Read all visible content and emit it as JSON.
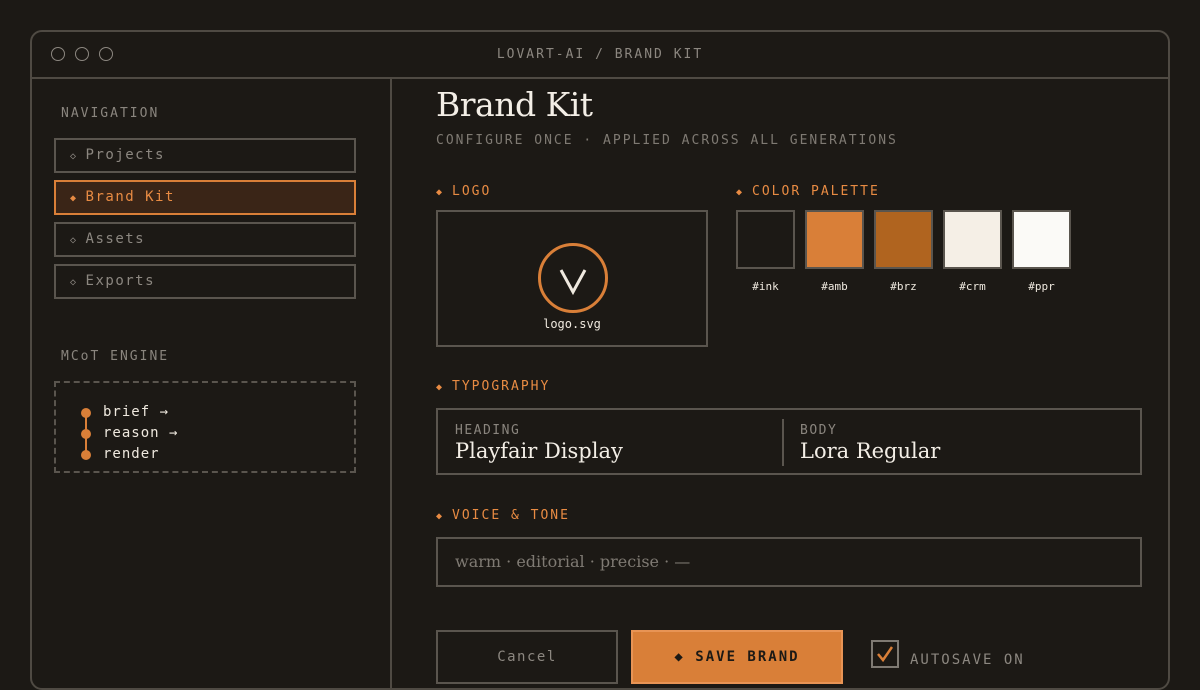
{
  "window": {
    "title": "LOVART-AI / BRAND KIT"
  },
  "sidebar": {
    "nav_label": "NAVIGATION",
    "items": [
      {
        "label": "Projects",
        "active": false
      },
      {
        "label": "Brand Kit",
        "active": true
      },
      {
        "label": "Assets",
        "active": false
      },
      {
        "label": "Exports",
        "active": false
      }
    ],
    "engine_label": "MCoT ENGINE",
    "engine_steps": [
      "brief →",
      "reason →",
      "render"
    ]
  },
  "main": {
    "title": "Brand Kit",
    "subtitle": "CONFIGURE ONCE · APPLIED ACROSS ALL GENERATIONS",
    "logo": {
      "label": "LOGO",
      "filename": "logo.svg"
    },
    "palette": {
      "label": "COLOR PALETTE",
      "swatches": [
        {
          "name": "#ink",
          "color": "#1c1915"
        },
        {
          "name": "#amb",
          "color": "#d97f38"
        },
        {
          "name": "#brz",
          "color": "#b0641f"
        },
        {
          "name": "#crm",
          "color": "#f5efe6"
        },
        {
          "name": "#ppr",
          "color": "#fbfaf7"
        }
      ]
    },
    "typography": {
      "label": "TYPOGRAPHY",
      "heading_caption": "HEADING",
      "heading_font": "Playfair Display",
      "body_caption": "BODY",
      "body_font": "Lora Regular"
    },
    "voice": {
      "label": "VOICE & TONE",
      "value": "warm · editorial · precise · —"
    },
    "actions": {
      "cancel_label": "Cancel",
      "save_label": "◆ SAVE BRAND",
      "autosave_label": "AUTOSAVE ON",
      "autosave_checked": true
    }
  },
  "colors": {
    "accent": "#d97f38",
    "background": "#1c1915",
    "border": "#4f4a43"
  }
}
